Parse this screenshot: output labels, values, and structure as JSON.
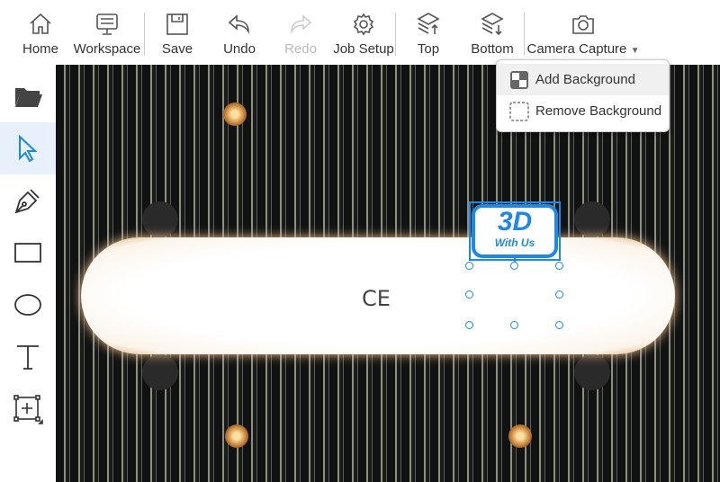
{
  "toolbar": {
    "items": [
      {
        "id": "home",
        "label": "Home",
        "icon": "home-icon"
      },
      {
        "id": "workspace",
        "label": "Workspace",
        "icon": "workspace-icon"
      },
      {
        "id": "save",
        "label": "Save",
        "icon": "save-icon"
      },
      {
        "id": "undo",
        "label": "Undo",
        "icon": "undo-icon"
      },
      {
        "id": "redo",
        "label": "Redo",
        "icon": "redo-icon",
        "disabled": true
      },
      {
        "id": "job-setup",
        "label": "Job Setup",
        "icon": "gear-icon"
      },
      {
        "id": "top",
        "label": "Top",
        "icon": "layers-up-icon"
      },
      {
        "id": "bottom",
        "label": "Bottom",
        "icon": "layers-down-icon"
      },
      {
        "id": "camera-capture",
        "label": "Camera Capture",
        "icon": "camera-icon"
      }
    ]
  },
  "camera_menu": {
    "items": [
      {
        "label": "Add Background",
        "icon": "add-background-icon"
      },
      {
        "label": "Remove Background",
        "icon": "remove-background-icon"
      }
    ]
  },
  "left_tools": [
    "folder-icon",
    "pointer-icon",
    "pen-icon",
    "rectangle-icon",
    "ellipse-icon",
    "text-icon",
    "frame-icon"
  ],
  "canvas": {
    "ce_mark": "CE",
    "logo": {
      "line1": "3D",
      "line2": "With Us"
    }
  },
  "colors": {
    "accent": "#1e88e5"
  }
}
